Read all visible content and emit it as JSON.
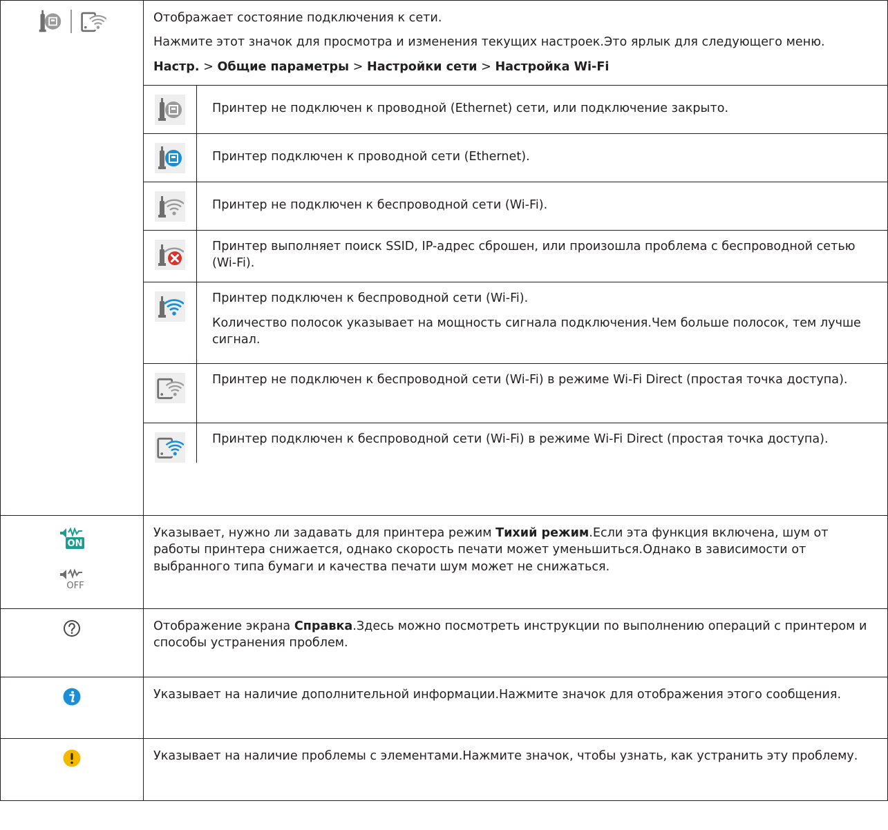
{
  "network": {
    "summary": "Отображает состояние подключения к сети.",
    "hint": "Нажмите этот значок для просмотра и изменения текущих настроек.Это ярлык для следующего меню.",
    "path": {
      "part1": "Настр.",
      "sep": ">",
      "part2": "Общие параметры",
      "part3": "Настройки сети",
      "part4": "Настройка Wi-Fi"
    },
    "items": [
      {
        "icon": "ethernet-disconnected-icon",
        "text": "Принтер не подключен к проводной (Ethernet) сети, или подключение закрыто."
      },
      {
        "icon": "ethernet-connected-icon",
        "text": "Принтер подключен к проводной сети (Ethernet)."
      },
      {
        "icon": "wifi-disconnected-icon",
        "text": "Принтер не подключен к беспроводной сети (Wi-Fi)."
      },
      {
        "icon": "wifi-error-icon",
        "text": "Принтер выполняет поиск SSID, IP-адрес сброшен, или произошла проблема с беспроводной сетью (Wi-Fi)."
      },
      {
        "icon": "wifi-connected-icon",
        "text": "Принтер подключен к беспроводной сети (Wi-Fi).",
        "extra": "Количество полосок указывает на мощность сигнала подключения.Чем больше полосок, тем лучше сигнал."
      },
      {
        "icon": "wifi-direct-disconnected-icon",
        "text": "Принтер не подключен к беспроводной сети (Wi-Fi) в режиме Wi-Fi Direct (простая точка доступа)."
      },
      {
        "icon": "wifi-direct-connected-icon",
        "text": "Принтер подключен к беспроводной сети (Wi-Fi) в режиме Wi-Fi Direct (простая точка доступа)."
      }
    ]
  },
  "quiet": {
    "icon_on_label": "ON",
    "icon_off_label": "OFF",
    "pre": "Указывает, нужно ли задавать для принтера режим ",
    "bold": "Тихий режим",
    "post": ".Если эта функция включена, шум от работы принтера снижается, однако скорость печати может уменьшиться.Однако в зависимости от выбранного типа бумаги и качества печати шум может не снижаться."
  },
  "help": {
    "pre": "Отображение экрана ",
    "bold": "Справка",
    "post": ".Здесь можно посмотреть инструкции по выполнению операций с принтером и способы устранения проблем."
  },
  "info": {
    "text": "Указывает на наличие дополнительной информации.Нажмите значок для отображения этого сообщения."
  },
  "warning": {
    "text": "Указывает на наличие проблемы с элементами.Нажмите значок, чтобы узнать, как устранить эту проблему."
  },
  "colors": {
    "border": "#231f20",
    "text": "#231f20",
    "icon_blue": "#1a8fd6",
    "icon_grey": "#8a8a8a",
    "icon_tile_bg": "#eeeeee",
    "error_red": "#d9342b",
    "warning_yellow": "#f5b800",
    "quiet_on_green": "#1a9e8f"
  }
}
